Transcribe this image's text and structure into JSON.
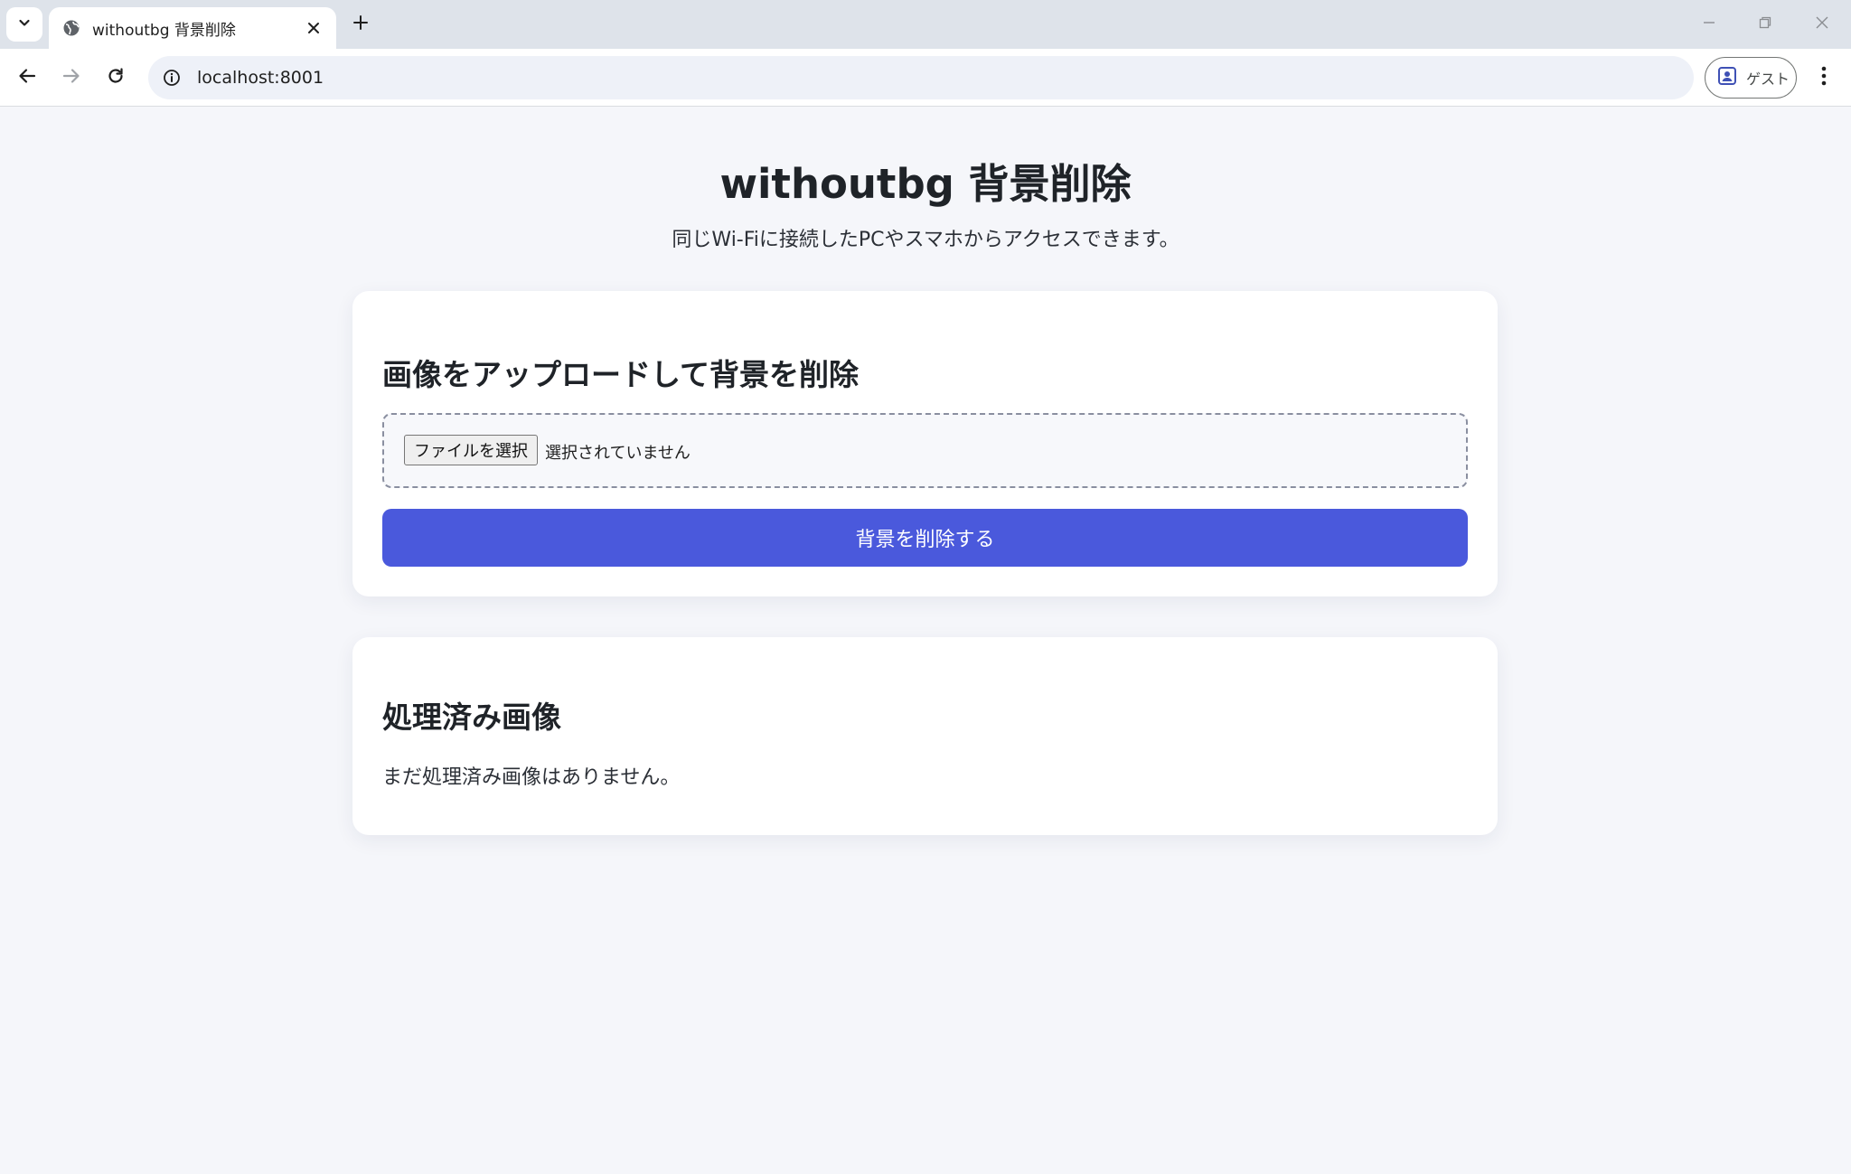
{
  "browser": {
    "tab": {
      "title": "withoutbg 背景削除",
      "favicon": "globe-icon",
      "close_icon": "close-icon"
    },
    "tab_menu_icon": "chevron-down-icon",
    "new_tab_icon": "plus-icon",
    "window_controls": [
      "minimize-icon",
      "restore-icon",
      "close-icon"
    ],
    "nav": {
      "back_icon": "arrow-left-icon",
      "forward_icon": "arrow-right-icon",
      "reload_icon": "reload-icon"
    },
    "address_bar": {
      "site_info_icon": "info-icon",
      "url": "localhost:8001"
    },
    "profile": {
      "icon": "person-badge-icon",
      "label": "ゲスト"
    },
    "menu_icon": "more-vert-icon"
  },
  "page": {
    "title": "withoutbg 背景削除",
    "subtitle": "同じWi-Fiに接続したPCやスマホからアクセスできます。"
  },
  "upload_card": {
    "heading": "画像をアップロードして背景を削除",
    "file_input": {
      "button_label": "ファイルを選択",
      "status": "選択されていません"
    },
    "submit_label": "背景を削除する"
  },
  "processed_card": {
    "heading": "処理済み画像",
    "empty_message": "まだ処理済み画像はありません。"
  },
  "colors": {
    "accent": "#4a59dc",
    "page_background": "#f5f6fa",
    "card_background": "#ffffff",
    "tabstrip": "#dee3ea"
  }
}
